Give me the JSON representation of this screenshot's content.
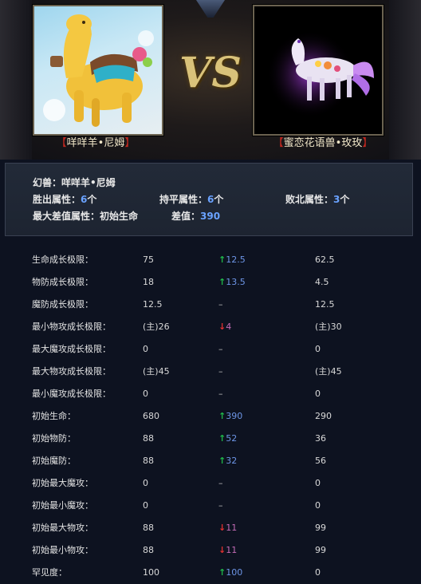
{
  "banner": {
    "vs_text": "VS",
    "left_pet": "咩咩羊•尼姆",
    "right_pet": "蜜恋花语兽•玫玫",
    "bracket_open": "【",
    "bracket_close": "】"
  },
  "summary": {
    "pet_label": "幻兽：",
    "pet_name": "咩咩羊•尼姆",
    "win_label": "胜出属性：",
    "win_count": "6",
    "tie_label": "持平属性：",
    "tie_count": "6",
    "lose_label": "败北属性：",
    "lose_count": "3",
    "unit": "个",
    "max_diff_label": "最大差值属性：",
    "max_diff_attr": "初始生命",
    "diff_label": "差值：",
    "diff_value": "390"
  },
  "rows": [
    {
      "label": "生命成长极限：",
      "left": "75",
      "arrow": "up",
      "diff": "12.5",
      "right": "62.5"
    },
    {
      "label": "物防成长极限：",
      "left": "18",
      "arrow": "up",
      "diff": "13.5",
      "right": "4.5"
    },
    {
      "label": "魔防成长极限：",
      "left": "12.5",
      "arrow": "none",
      "diff": "–",
      "right": "12.5"
    },
    {
      "label": "最小物攻成长极限：",
      "left": "(主)26",
      "arrow": "down",
      "diff": "4",
      "right": "(主)30"
    },
    {
      "label": "最大魔攻成长极限：",
      "left": "0",
      "arrow": "none",
      "diff": "–",
      "right": "0"
    },
    {
      "label": "最大物攻成长极限：",
      "left": "(主)45",
      "arrow": "none",
      "diff": "–",
      "right": "(主)45"
    },
    {
      "label": "最小魔攻成长极限：",
      "left": "0",
      "arrow": "none",
      "diff": "–",
      "right": "0"
    },
    {
      "label": "初始生命：",
      "left": "680",
      "arrow": "up",
      "diff": "390",
      "right": "290"
    },
    {
      "label": "初始物防：",
      "left": "88",
      "arrow": "up",
      "diff": "52",
      "right": "36"
    },
    {
      "label": "初始魔防：",
      "left": "88",
      "arrow": "up",
      "diff": "32",
      "right": "56"
    },
    {
      "label": "初始最大魔攻：",
      "left": "0",
      "arrow": "none",
      "diff": "–",
      "right": "0"
    },
    {
      "label": "初始最小魔攻：",
      "left": "0",
      "arrow": "none",
      "diff": "–",
      "right": "0"
    },
    {
      "label": "初始最大物攻：",
      "left": "88",
      "arrow": "down",
      "diff": "11",
      "right": "99"
    },
    {
      "label": "初始最小物攻：",
      "left": "88",
      "arrow": "down",
      "diff": "11",
      "right": "99"
    },
    {
      "label": "罕见度：",
      "left": "100",
      "arrow": "up",
      "diff": "100",
      "right": "0"
    }
  ],
  "icons": {
    "up": "↑",
    "down": "↓"
  },
  "colors": {
    "background": "#0d1220",
    "highlight_number": "#6aa2ff",
    "arrow_up": "#1fb84a",
    "arrow_down": "#e03030",
    "vs_gold": "#d9c27a",
    "bracket_red": "#c0271f"
  }
}
